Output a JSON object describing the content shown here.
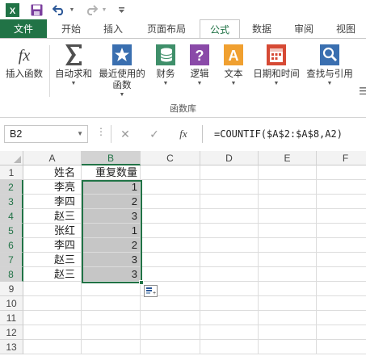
{
  "tabs": [
    "文件",
    "开始",
    "插入",
    "页面布局",
    "公式",
    "数据",
    "审阅",
    "视图"
  ],
  "ribbon": {
    "group_label": "函数库",
    "buttons": [
      {
        "label": "插入函数",
        "icon": "insert-function-icon",
        "dropdown": false
      },
      {
        "label": "自动求和",
        "icon": "autosum-icon",
        "dropdown": true
      },
      {
        "label": "最近使用的 函数",
        "icon": "recently-used-star-icon",
        "dropdown": true
      },
      {
        "label": "财务",
        "icon": "financial-coins-icon",
        "dropdown": true
      },
      {
        "label": "逻辑",
        "icon": "logical-question-icon",
        "dropdown": true
      },
      {
        "label": "文本",
        "icon": "text-a-icon",
        "dropdown": true
      },
      {
        "label": "日期和时间",
        "icon": "date-time-calendar-icon",
        "dropdown": true
      },
      {
        "label": "查找与引用",
        "icon": "lookup-reference-icon",
        "dropdown": true
      }
    ]
  },
  "formula_bar": {
    "name_box": "B2",
    "formula": "=COUNTIF($A$2:$A$8,A2)"
  },
  "grid": {
    "columns": [
      "A",
      "B",
      "C",
      "D",
      "E",
      "F"
    ],
    "selected_column": "B",
    "rows": [
      "1",
      "2",
      "3",
      "4",
      "5",
      "6",
      "7",
      "8",
      "9",
      "10",
      "11",
      "12",
      "13"
    ],
    "col_a": [
      "姓名",
      "李亮",
      "李四",
      "赵三",
      "张红",
      "李四",
      "赵三",
      "赵三"
    ],
    "col_b": [
      "重复数量",
      "1",
      "2",
      "3",
      "1",
      "2",
      "3",
      "3"
    ]
  },
  "colors": {
    "accent": "#217346",
    "selection_fill": "#c6c6c6"
  }
}
